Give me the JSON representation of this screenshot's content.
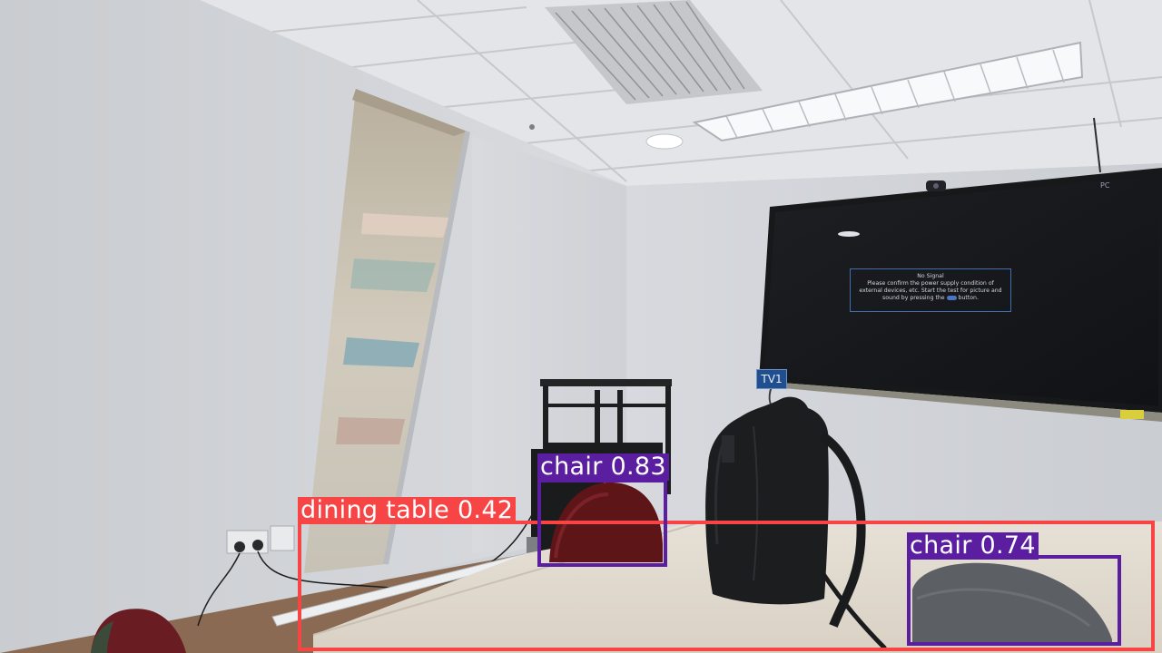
{
  "scene": {
    "colors": {
      "dining_table": "#f74545",
      "chair": "#5b1ea0"
    }
  },
  "tv": {
    "message_lines": [
      "No Signal",
      "Please confirm the power supply condition of",
      "external devices, etc. Start the test for picture and",
      "sound by pressing the",
      "button."
    ],
    "input_label": "PC",
    "tag": "TV1"
  },
  "detections": [
    {
      "label": "dining table 0.42",
      "class": "dining_table"
    },
    {
      "label": "chair 0.83",
      "class": "chair"
    },
    {
      "label": "chair 0.74",
      "class": "chair"
    }
  ]
}
